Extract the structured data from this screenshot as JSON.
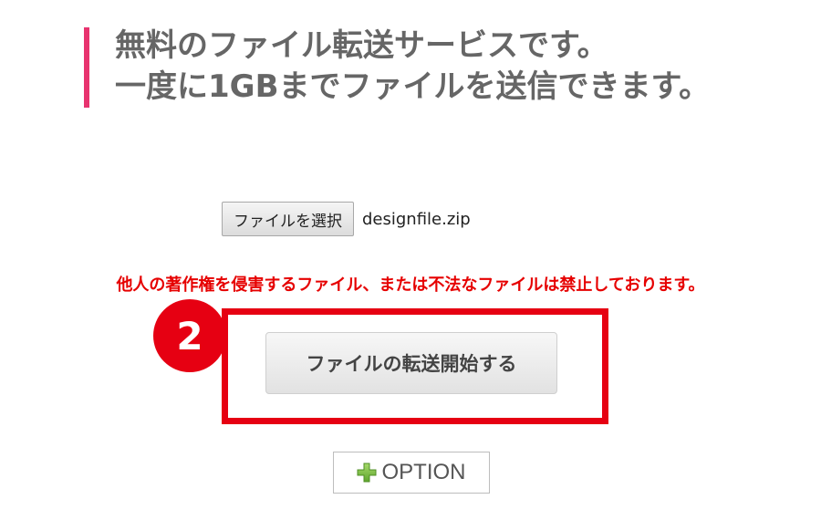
{
  "header": {
    "line1": "無料のファイル転送サービスです。",
    "line2": "一度に1GBまでファイルを送信できます。",
    "accent_color": "#e8336f"
  },
  "upload": {
    "choose_button_label": "ファイルを選択",
    "selected_file": "designfile.zip"
  },
  "warning": {
    "text": "他人の著作権を侵害するファイル、または不法なファイルは禁止しております。",
    "color": "#e60000"
  },
  "annotation": {
    "step_number": "2",
    "color": "#e60012"
  },
  "transfer": {
    "start_button_label": "ファイルの転送開始する"
  },
  "option": {
    "label": "OPTION",
    "icon": "plus-icon",
    "icon_color": "#7ac143"
  }
}
